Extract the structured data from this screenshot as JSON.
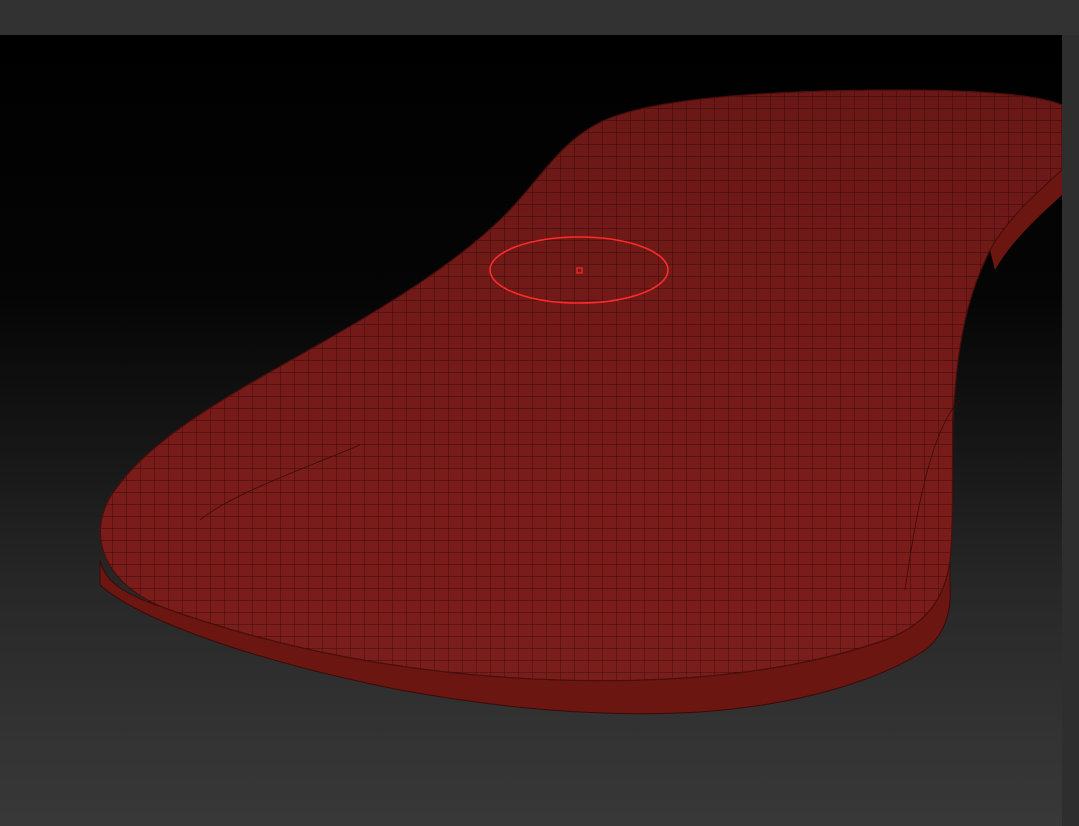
{
  "app": {
    "accent_color": "#ff2a2a",
    "canvas_background": "#000000"
  },
  "model": {
    "name": "",
    "mesh_color": "#7a1c1a",
    "wire_color": "#3a0a08",
    "side_color": "#6c1612",
    "wireframe_visible": true
  },
  "brush": {
    "cursor_color": "#ff2a2a",
    "shape": "circle"
  }
}
